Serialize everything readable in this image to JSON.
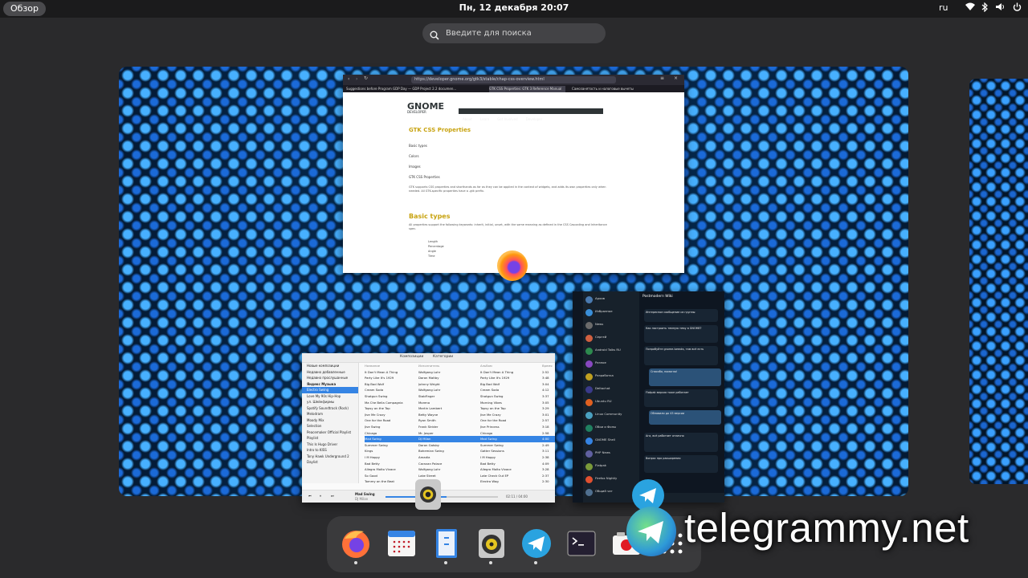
{
  "topbar": {
    "overview_label": "Обзор",
    "clock": "Пн, 12 декабря  20:07",
    "keyboard_layout": "ru"
  },
  "search": {
    "placeholder": "Введите для поиска"
  },
  "browser": {
    "url": "https://developer.gnome.org/gtk3/stable/chap-css-overview.html",
    "tabs": [
      "Suggestions before Program GDP Day — GDP Project 2.2 documen...",
      "GTK CSS Properties: GTK 3 Reference Manual",
      "Самозанятость и налоговые вычеты"
    ],
    "page": {
      "logo": "GNOME",
      "logo_sub": "DEVELOPER",
      "nav": [
        "About",
        "Learn",
        "Get Involved",
        "Developer"
      ],
      "title": "GTK CSS Properties",
      "toc": [
        "Basic types",
        "Colors",
        "Images",
        "GTK CSS Properties"
      ],
      "intro": "GTK supports CSS properties and shorthands as far as they can be applied in the context of widgets, and adds its own properties only when needed. All GTK-specific properties have a -gtk prefix.",
      "section": "Basic types",
      "section_text": "All properties support the following keywords: inherit, initial, unset, with the same meaning as defined in the CSS Cascading and Inheritance spec.",
      "code": [
        "Length",
        "Percentage",
        "Angle",
        "Time"
      ]
    }
  },
  "music": {
    "header_tabs": [
      "Композиции",
      "Категории"
    ],
    "sidebar": [
      "Новые композиции",
      "Недавно добавленные",
      "Недавно прослушанные",
      "Яндекс Музыка",
      "Electro Swing",
      "Love My 90s Hip-Hop",
      "ул. Шейнфирмы",
      "Spotify Soundtrack (Rock)",
      "Melodram",
      "Moody Mix",
      "Selection",
      "Peacemaker Official Playlist",
      "Playlist",
      "This Is Hugo Driver",
      "Intro to KISS",
      "Tony Hawk Underground 2",
      "Daylist"
    ],
    "columns": [
      "Название",
      "Исполнитель",
      "Альбом",
      "Время"
    ],
    "tracks": [
      [
        "It Don't Mean A Thing",
        "Wolfgang Lohr",
        "It Don't Mean A Thing",
        "2:52"
      ],
      [
        "Party Like It's 1929",
        "Daron Maltby",
        "Party Like It's 1929",
        "3:48"
      ],
      [
        "Big Bad Wolf",
        "Johnny Wright",
        "Big Bad Wolf",
        "3:04"
      ],
      [
        "Cream Soda",
        "Wolfgang Lohr",
        "Cream Soda",
        "4:12"
      ],
      [
        "Shotgun Swing",
        "StabFinger",
        "Shotgun Swing",
        "3:37"
      ],
      [
        "Ma Che Bella Compagnia",
        "Moreno",
        "Morning Vibes",
        "3:05"
      ],
      [
        "Topsy on the Top",
        "Martin Lambert",
        "Topsy on the Top",
        "3:29"
      ],
      [
        "Jive Me Crazy",
        "Betty Wayne",
        "Jive Me Crazy",
        "3:01"
      ],
      [
        "One for the Road",
        "Ryan Smith",
        "One for the Road",
        "2:57"
      ],
      [
        "Jive Swing",
        "Frank Strider",
        "Jive Princess",
        "3:18"
      ],
      [
        "Chicago",
        "Mr. Jasper",
        "Chicago",
        "2:58"
      ],
      [
        "Mad Swing",
        "DJ Milan",
        "Mad Swing",
        "4:00"
      ],
      [
        "Summer Swing",
        "Daron Gatsby",
        "Summer Swing",
        "2:49"
      ],
      [
        "Kings",
        "Bohemian Swing",
        "Gatter Sessions",
        "3:11"
      ],
      [
        "I M Happy",
        "Amadia",
        "I M Happy",
        "2:38"
      ],
      [
        "Bad Betty",
        "Caravan Palace",
        "Bad Betty",
        "4:09"
      ],
      [
        "Allegro Molto Vivace",
        "Wolfgang Lohr",
        "Allegro Molto Vivace",
        "3:28"
      ],
      [
        "So Good",
        "Lake Street",
        "Late Check Out EP",
        "2:37"
      ],
      [
        "Tommy on the Beat",
        "Les Babettes",
        "Electro Wag",
        "2:30"
      ]
    ],
    "now_playing_title": "Mad Swing",
    "now_playing_artist": "DJ Milan",
    "time": "02:11 / 04:00"
  },
  "telegram": {
    "title": "Postmodern Wiki",
    "chats": [
      "Архив",
      "Избранное",
      "News",
      "Сергей",
      "Android Talks RU",
      "Разное",
      "Разработка",
      "Deltachat",
      "Ubuntu RU",
      "Linux Community",
      "Обои и Фоны",
      "GNOME Shell",
      "PHP News",
      "Flatpak",
      "Firefox Nightly",
      "Общий чат"
    ],
    "messages": [
      "Интересное сообщение из группы",
      "Как настроить темную тему в GNOME?",
      "Попробуйте gnome-tweaks, там всё есть",
      "Спасибо, помогло!",
      "Flatpak версия тоже работает",
      "Обновили до 43 версии",
      "Ага, всё работает отлично",
      "Вопрос про расширения"
    ]
  },
  "dock": {
    "apps": [
      "Firefox",
      "Календарь",
      "Файлы",
      "Rhythmbox",
      "Telegram",
      "Терминал",
      "Снимок экрана",
      "Приложения"
    ]
  },
  "watermark": "telegrammy.net"
}
